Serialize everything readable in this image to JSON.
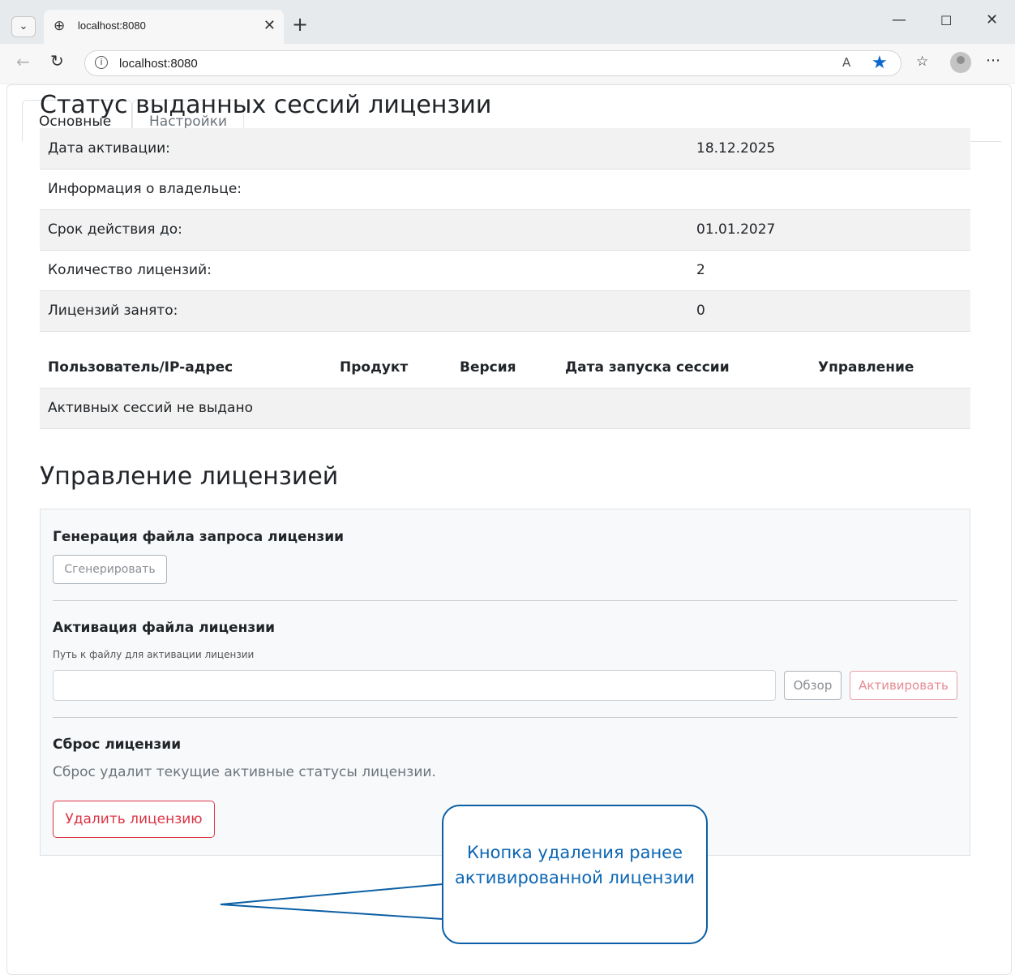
{
  "browser": {
    "tab_title": "localhost:8080",
    "url": "localhost:8080",
    "icons": {
      "tab_list": "chevron-down-icon",
      "tab_favicon": "globe-icon",
      "tab_close": "close-icon",
      "new_tab": "plus-icon",
      "back": "arrow-left-icon",
      "reload": "reload-icon",
      "site_info": "info-icon",
      "read_aloud": "read-aloud-icon",
      "favorite": "star-icon",
      "favorites_list": "favorites-icon",
      "profile": "avatar-icon",
      "more": "more-icon"
    },
    "glyphs": {
      "tab_list": "⌄",
      "tab_favicon": "⊕",
      "tab_close": "✕",
      "new_tab": "+",
      "minimize": "—",
      "maximize": "☐",
      "close": "✕",
      "back": "←",
      "reload": "↻",
      "site_info": "i",
      "read_aloud": "A",
      "favorite": "★",
      "favorites_list": "☆",
      "more": "⋯"
    }
  },
  "tabs": [
    {
      "label": "Основные",
      "active": true
    },
    {
      "label": "Настройки",
      "active": false
    }
  ],
  "status": {
    "title": "Статус выданных сессий лицензии",
    "rows": [
      {
        "label": "Дата активации:",
        "value": "18.12.2025"
      },
      {
        "label": "Информация о владельце:",
        "value": ""
      },
      {
        "label": "Срок действия до:",
        "value": "01.01.2027"
      },
      {
        "label": "Количество лицензий:",
        "value": "2"
      },
      {
        "label": "Лицензий занято:",
        "value": "0"
      }
    ]
  },
  "sessions": {
    "headers": {
      "user": "Пользователь/IP-адрес",
      "product": "Продукт",
      "version": "Версия",
      "start": "Дата запуска сессии",
      "control": "Управление"
    },
    "empty_text": "Активных сессий не выдано"
  },
  "management": {
    "title": "Управление лицензией",
    "generate": {
      "title": "Генерация файла запроса лицензии",
      "button": "Сгенерировать"
    },
    "activate": {
      "title": "Активация файла лицензии",
      "label": "Путь к файлу для активации лицензии",
      "value": "",
      "browse_button": "Обзор",
      "activate_button": "Активировать"
    },
    "reset": {
      "title": "Сброс лицензии",
      "description": "Сброс удалит текущие активные статусы лицензии.",
      "button": "Удалить лицензию"
    }
  },
  "callout": {
    "text": "Кнопка удаления ранее активированной лицензии",
    "color": "#0b5fa5"
  }
}
